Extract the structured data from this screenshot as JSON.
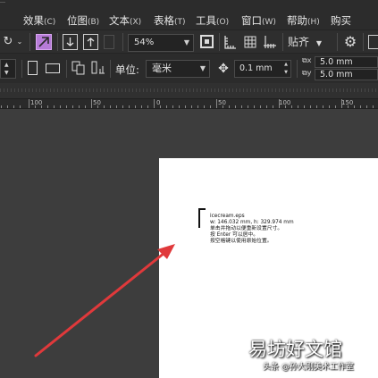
{
  "menu": {
    "items": [
      {
        "label": "效果",
        "accel": "(C)"
      },
      {
        "label": "位图",
        "accel": "(B)"
      },
      {
        "label": "文本",
        "accel": "(X)"
      },
      {
        "label": "表格",
        "accel": "(T)"
      },
      {
        "label": "工具",
        "accel": "(O)"
      },
      {
        "label": "窗口",
        "accel": "(W)"
      },
      {
        "label": "帮助",
        "accel": "(H)"
      },
      {
        "label": "购买",
        "accel": ""
      }
    ]
  },
  "toolbar": {
    "zoom_value": "54%",
    "snap_label": "贴齐",
    "unit_label": "单位:",
    "unit_value": "毫米",
    "nudge_value": "0.1 mm",
    "dup_x": "5.0 mm",
    "dup_y": "5.0 mm"
  },
  "ruler": {
    "labels": [
      "100",
      "50",
      "0",
      "50",
      "100",
      "150"
    ]
  },
  "cursor_tip": {
    "file": "icecream.eps",
    "size": "w: 146.032 mm, h: 329.974 mm",
    "line1": "单击并拖动以便重新设置尺寸。",
    "line2": "按 Enter 可以居中。",
    "line3": "按空格键以使用原始位置。"
  },
  "watermark": {
    "big": "易坊好文馆",
    "small": "头条 @孙大刚美术工作室"
  },
  "colors": {
    "menubar_bg": "#2c2c2c",
    "canvas_bg": "#3d3d3d",
    "page_bg": "#ffffff",
    "arrow": "#e0393b",
    "accent_icon": "#b77bd8"
  }
}
